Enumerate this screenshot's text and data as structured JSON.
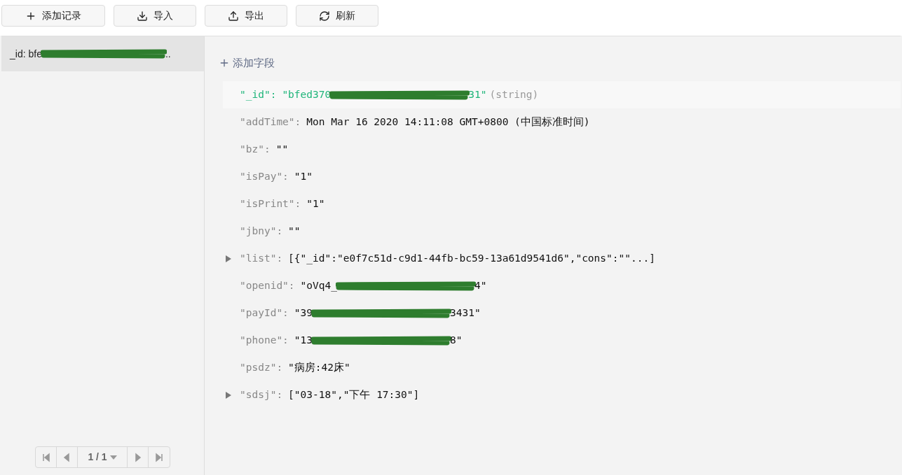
{
  "toolbar": [
    {
      "kind": "plus",
      "label": "添加记录"
    },
    {
      "kind": "download",
      "label": "导入"
    },
    {
      "kind": "upload",
      "label": "导出"
    },
    {
      "kind": "refresh",
      "label": "刷新"
    }
  ],
  "records": [
    {
      "label_start": "_id: bfe",
      "label_end": "..",
      "redacted": true,
      "selected": true
    }
  ],
  "pagination": {
    "page": "1 / 1"
  },
  "add_field": "添加字段",
  "fields": [
    {
      "key": "\"_id\":",
      "value": "\"bfed370",
      "value_end": "31\"",
      "redacted": true,
      "type_hint": "(string)",
      "highlighted": true,
      "expandable": false
    },
    {
      "key": "\"addTime\":",
      "value": "Mon Mar 16 2020 14:11:08 GMT+0800 (中国标准时间)",
      "redacted": false,
      "highlighted": false,
      "expandable": false
    },
    {
      "key": "\"bz\":",
      "value": "\"\"",
      "redacted": false,
      "highlighted": false,
      "expandable": false
    },
    {
      "key": "\"isPay\":",
      "value": "\"1\"",
      "redacted": false,
      "highlighted": false,
      "expandable": false
    },
    {
      "key": "\"isPrint\":",
      "value": "\"1\"",
      "redacted": false,
      "highlighted": false,
      "expandable": false
    },
    {
      "key": "\"jbny\":",
      "value": "\"\"",
      "redacted": false,
      "highlighted": false,
      "expandable": false
    },
    {
      "key": "\"list\":",
      "value": "[{\"_id\":\"e0f7c51d-c9d1-44fb-bc59-13a61d9541d6\",\"cons\":\"\"...]",
      "redacted": false,
      "highlighted": false,
      "expandable": true
    },
    {
      "key": "\"openid\":",
      "value": "\"oVq4_",
      "value_end": "4\"",
      "redacted": true,
      "highlighted": false,
      "expandable": false
    },
    {
      "key": "\"payId\":",
      "value": "\"39",
      "value_end": "3431\"",
      "redacted": true,
      "highlighted": false,
      "expandable": false
    },
    {
      "key": "\"phone\":",
      "value": "\"13",
      "value_end": "8\"",
      "redacted": true,
      "highlighted": false,
      "expandable": false
    },
    {
      "key": "\"psdz\":",
      "value": "\"病房:42床\"",
      "redacted": false,
      "highlighted": false,
      "expandable": false
    },
    {
      "key": "\"sdsj\":",
      "value": "[\"03-18\",\"下午 17:30\"]",
      "redacted": false,
      "highlighted": false,
      "expandable": true
    }
  ]
}
